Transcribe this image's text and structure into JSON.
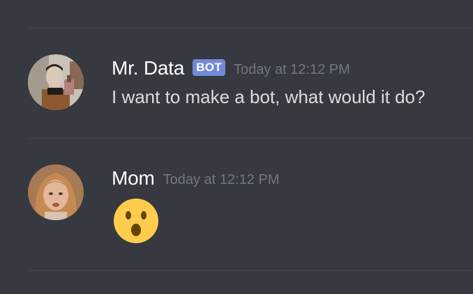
{
  "colors": {
    "background": "#36393f",
    "divider": "#42454a",
    "username": "#ffffff",
    "message_text": "#dcddde",
    "timestamp": "#72767d",
    "bot_tag": "#7289da",
    "emoji_face": "#ffcc4d"
  },
  "messages": [
    {
      "author": "Mr. Data",
      "bot_tag": "BOT",
      "timestamp": "Today at 12:12 PM",
      "content": "I want to make a bot, what would it do?",
      "avatar_icon": "user-avatar"
    },
    {
      "author": "Mom",
      "timestamp": "Today at 12:12 PM",
      "emoji": "hushed-face-emoji",
      "avatar_icon": "user-avatar"
    }
  ]
}
